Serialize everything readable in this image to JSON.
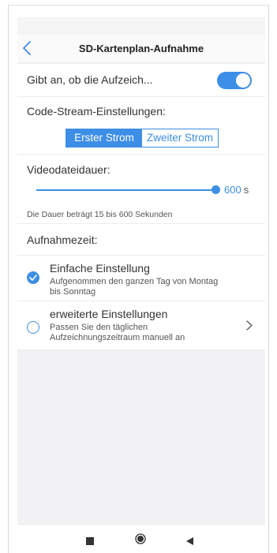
{
  "header": {
    "title": "SD-Kartenplan-Aufnahme"
  },
  "recording": {
    "label": "Gibt an, ob die Aufzeich...",
    "enabled": true
  },
  "stream": {
    "label": "Code-Stream-Einstellungen:",
    "options": [
      "Erster Strom",
      "Zweiter Strom"
    ],
    "selected": "Erster Strom"
  },
  "duration": {
    "label": "Videodateidauer:",
    "value": "600",
    "unit": "s",
    "hint": "Die Dauer beträgt 15 bis 600 Sekunden",
    "min": 15,
    "max": 600,
    "level_fraction": 1.0
  },
  "schedule": {
    "label": "Aufnahmezeit:",
    "options": [
      {
        "title": "Einfache Einstellung",
        "desc": "Aufgenommen den ganzen Tag von Montag bis Sonntag",
        "checked": true
      },
      {
        "title": "erweiterte Einstellungen",
        "desc": "Passen Sie den täglichen Aufzeichnungszeitraum manuell an",
        "checked": false
      }
    ]
  },
  "colors": {
    "accent": "#3d8ee6",
    "background": "#f2f2f4"
  },
  "icons": {
    "back": "chevron-left-icon",
    "forward": "chevron-right-icon",
    "check": "check-icon",
    "nav_square": "stop-square-icon",
    "nav_home": "home-circle-icon",
    "nav_back": "back-triangle-icon"
  }
}
